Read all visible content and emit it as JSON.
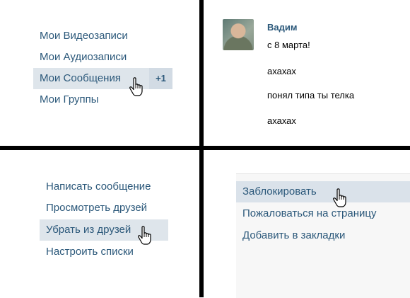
{
  "sidebar": {
    "items": [
      {
        "label": "Мои Видеозаписи"
      },
      {
        "label": "Мои Аудиозаписи"
      },
      {
        "label": "Мои Сообщения",
        "counter": "+1"
      },
      {
        "label": "Мои Группы"
      }
    ]
  },
  "conversation": {
    "sender": "Вадим",
    "messages": [
      "с 8 марта!",
      "ахахах",
      "понял типа ты телка",
      "ахахах"
    ]
  },
  "friend_actions": {
    "items": [
      {
        "label": "Написать сообщение"
      },
      {
        "label": "Просмотреть друзей"
      },
      {
        "label": "Убрать из друзей"
      },
      {
        "label": "Настроить списки"
      }
    ]
  },
  "profile_menu": {
    "items": [
      {
        "label": "Заблокировать"
      },
      {
        "label": "Пожаловаться на страницу"
      },
      {
        "label": "Добавить в закладки"
      }
    ]
  },
  "colors": {
    "link": "#2b587a",
    "highlight": "#dee5eb",
    "divider": "#000000"
  }
}
